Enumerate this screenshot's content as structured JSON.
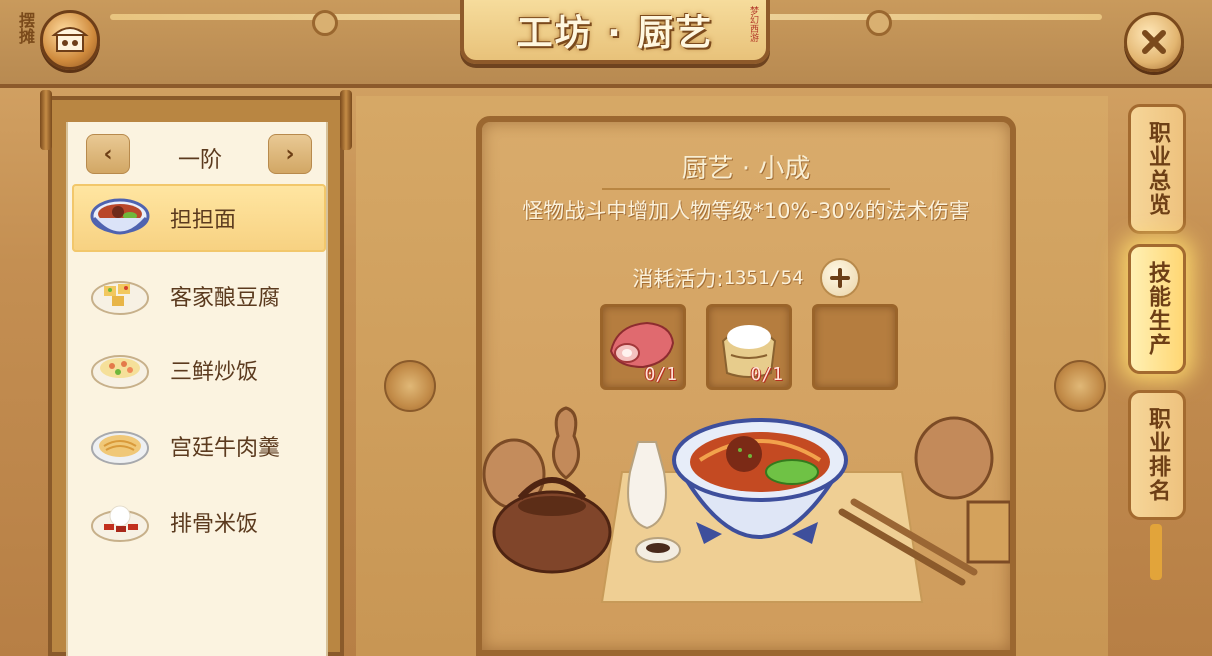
{
  "header": {
    "title": "工坊 · 厨艺",
    "stall_label": "摆摊",
    "seal_text": "梦幻西游"
  },
  "recipe_list": {
    "tier_label": "一阶",
    "items": [
      {
        "label": "担担面",
        "selected": true
      },
      {
        "label": "客家酿豆腐",
        "selected": false
      },
      {
        "label": "三鲜炒饭",
        "selected": false
      },
      {
        "label": "宫廷牛肉羹",
        "selected": false
      },
      {
        "label": "排骨米饭",
        "selected": false
      }
    ]
  },
  "skill": {
    "title": "厨艺 · 小成",
    "description": "怪物战斗中增加人物等级*10%-30%的法术伤害",
    "cost_label": "消耗活力:",
    "cost_value": "1351/54"
  },
  "ingredients": [
    {
      "icon": "meat-icon",
      "count": "0/1"
    },
    {
      "icon": "flour-sack-icon",
      "count": "0/1"
    },
    {
      "icon": "",
      "count": ""
    }
  ],
  "side_tabs": [
    {
      "label": "职业总览",
      "active": false
    },
    {
      "label": "技能生产",
      "active": true
    },
    {
      "label": "职业排名",
      "active": false
    }
  ],
  "colors": {
    "accent_gold": "#f2c76b",
    "panel_cream": "#fbf3e0",
    "text_brown": "#5b3a1e",
    "count_red": "#b5301f"
  }
}
